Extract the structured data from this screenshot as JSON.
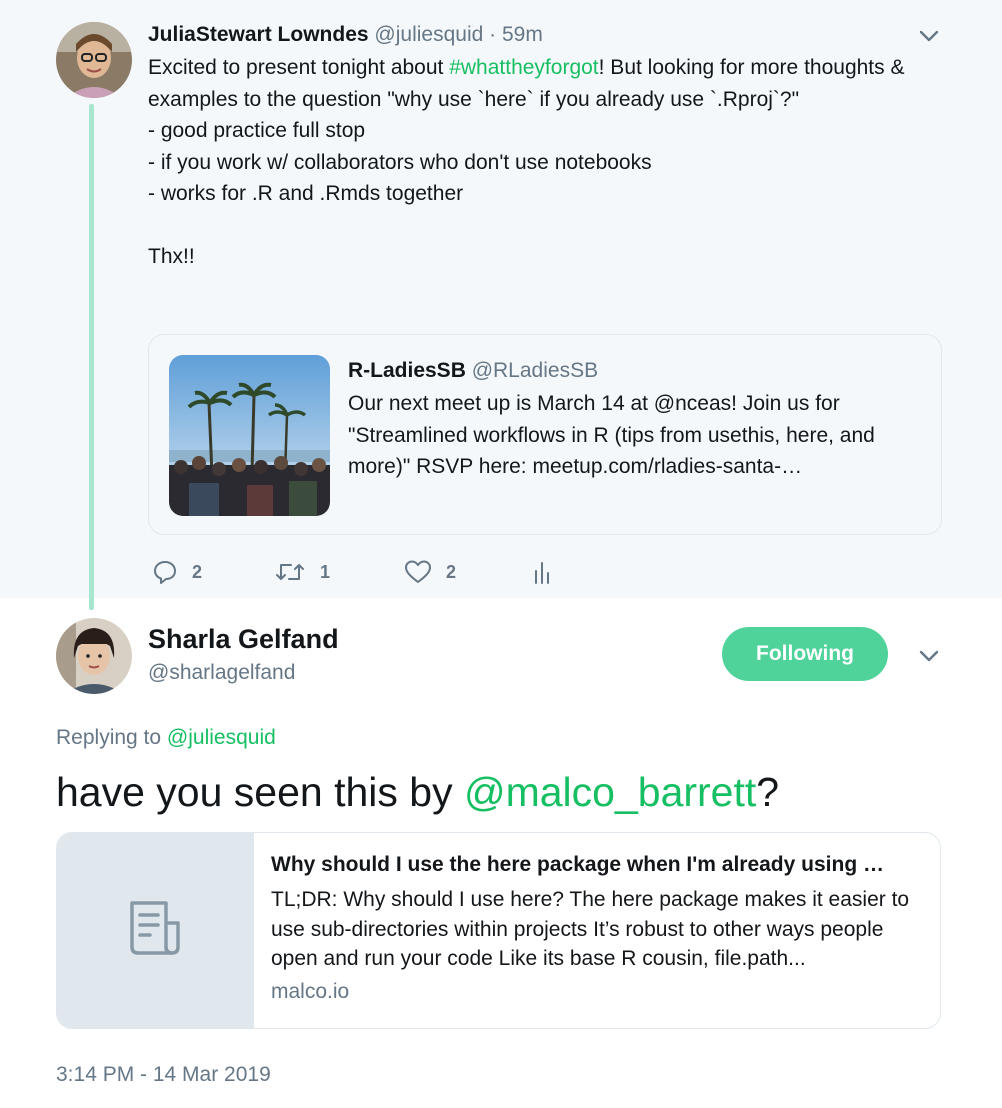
{
  "parent_tweet": {
    "author_name": "JuliaStewart Lowndes",
    "handle": "@juliesquid",
    "separator": "·",
    "time": "59m",
    "text_before_hashtag": "Excited to present tonight about  ",
    "hashtag": "#whattheyforgot",
    "text_after_hashtag": "! But looking for more thoughts & examples to the question \"why use `here` if you already use `.Rproj`?\"\n- good practice full stop\n- if you work w/ collaborators who don't use notebooks\n- works for .R and .Rmds together\n\nThx!!",
    "quoted": {
      "author_name": "R-LadiesSB",
      "handle": "@RLadiesSB",
      "text": "Our next meet up is March 14 at @nceas! Join us for \"Streamlined workflows in R (tips from usethis, here, and more)\" RSVP here: meetup.com/rladies-santa-…"
    },
    "actions": {
      "reply_count": "2",
      "retweet_count": "1",
      "like_count": "2"
    }
  },
  "reply_tweet": {
    "author_name": "Sharla Gelfand",
    "handle": "@sharlagelfand",
    "follow_button_label": "Following",
    "replying_prefix": "Replying to ",
    "replying_to": "@juliesquid",
    "text_before_mention": "have you seen this by ",
    "mention": "@malco_barrett",
    "text_after_mention": "?",
    "card": {
      "title": "Why should I use the here package when I'm already using …",
      "description": "TL;DR: Why should I use here? The here package makes it easier to use sub-directories within projects It’s robust to other ways people open and run your code Like its base R cousin, file.path...",
      "domain": "malco.io"
    },
    "timestamp": "3:14 PM - 14 Mar 2019"
  },
  "colors": {
    "accent": "#17bf63",
    "follow_button": "#4fd39a",
    "thread_line": "#a8e6cf",
    "secondary_text": "#657786",
    "parent_background": "#f5f8fa"
  },
  "icons": [
    "chevron-down-icon",
    "reply-icon",
    "retweet-icon",
    "heart-icon",
    "analytics-icon",
    "document-icon"
  ]
}
